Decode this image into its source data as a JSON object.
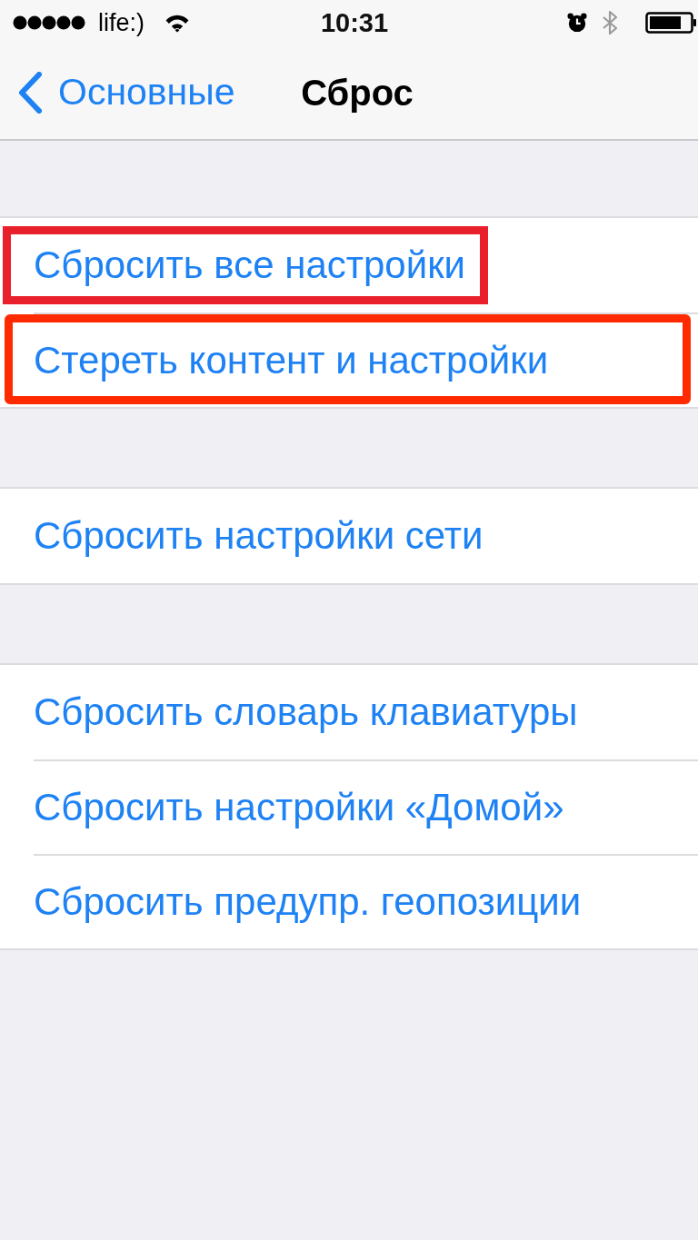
{
  "status_bar": {
    "carrier": "life:)",
    "time": "10:31"
  },
  "nav_bar": {
    "back_label": "Основные",
    "title": "Сброс"
  },
  "groups": [
    {
      "rows": [
        {
          "label": "Сбросить все настройки",
          "highlight": {
            "kind": "label",
            "color": "#e8202b"
          }
        },
        {
          "label": "Стереть контент и настройки",
          "highlight": {
            "kind": "row",
            "color": "#ff2a00"
          }
        }
      ]
    },
    {
      "rows": [
        {
          "label": "Сбросить настройки сети"
        }
      ]
    },
    {
      "rows": [
        {
          "label": "Сбросить словарь клавиатуры"
        },
        {
          "label": "Сбросить настройки «Домой»"
        },
        {
          "label": "Сбросить предупр. геопозиции"
        }
      ]
    }
  ]
}
